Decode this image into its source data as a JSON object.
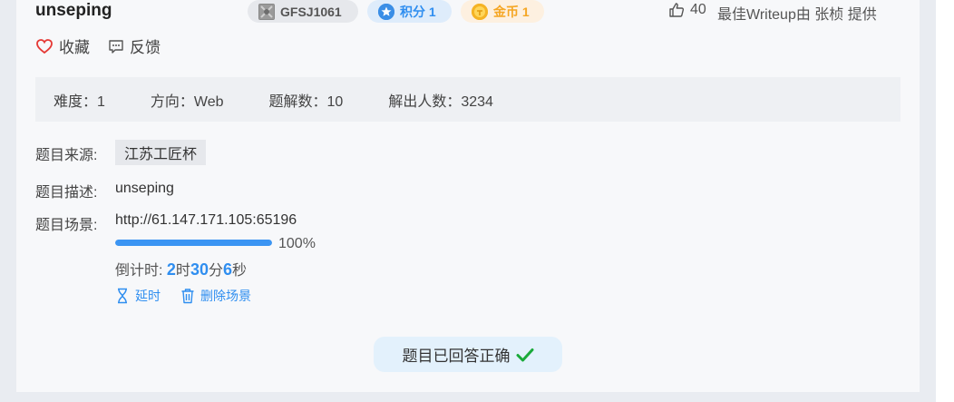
{
  "challenge": {
    "title": "unseping",
    "tags": {
      "id_label": "GFSJ1061",
      "score_label": "积分 1",
      "coin_label": "金币 1"
    },
    "likes": "40",
    "writeup_text": "最佳Writeup由 张桢 提供"
  },
  "actions": {
    "favorite": "收藏",
    "feedback": "反馈"
  },
  "info": {
    "difficulty": "难度：1",
    "direction": "方向：Web",
    "solves": "题解数：10",
    "solvers": "解出人数：3234"
  },
  "details": {
    "source_label": "题目来源:",
    "source_value": "江苏工匠杯",
    "desc_label": "题目描述:",
    "desc_value": "unseping",
    "scene_label": "题目场景:",
    "scene_url": "http://61.147.171.105:65196",
    "progress_percent": 100,
    "progress_text": "100%",
    "countdown": {
      "prefix": "倒计时: ",
      "hours": "2",
      "hours_unit": "时",
      "minutes": "30",
      "minutes_unit": "分",
      "seconds": "6",
      "seconds_unit": "秒"
    },
    "extend_label": "延时",
    "delete_label": "删除场景"
  },
  "status": {
    "solved_text": "题目已回答正确"
  },
  "colors": {
    "accent": "#2f8ef0",
    "progress": "#3b95f3",
    "success": "#1aaa3a",
    "heart": "#e53935",
    "coin": "#f5a623"
  },
  "icons": {
    "id": "id-badge-icon",
    "score": "star-badge-icon",
    "coin": "coin-icon",
    "like": "thumbs-up-icon",
    "favorite": "heart-icon",
    "feedback": "comment-icon",
    "extend": "hourglass-icon",
    "delete": "trash-icon",
    "solved": "checkmark-icon"
  }
}
